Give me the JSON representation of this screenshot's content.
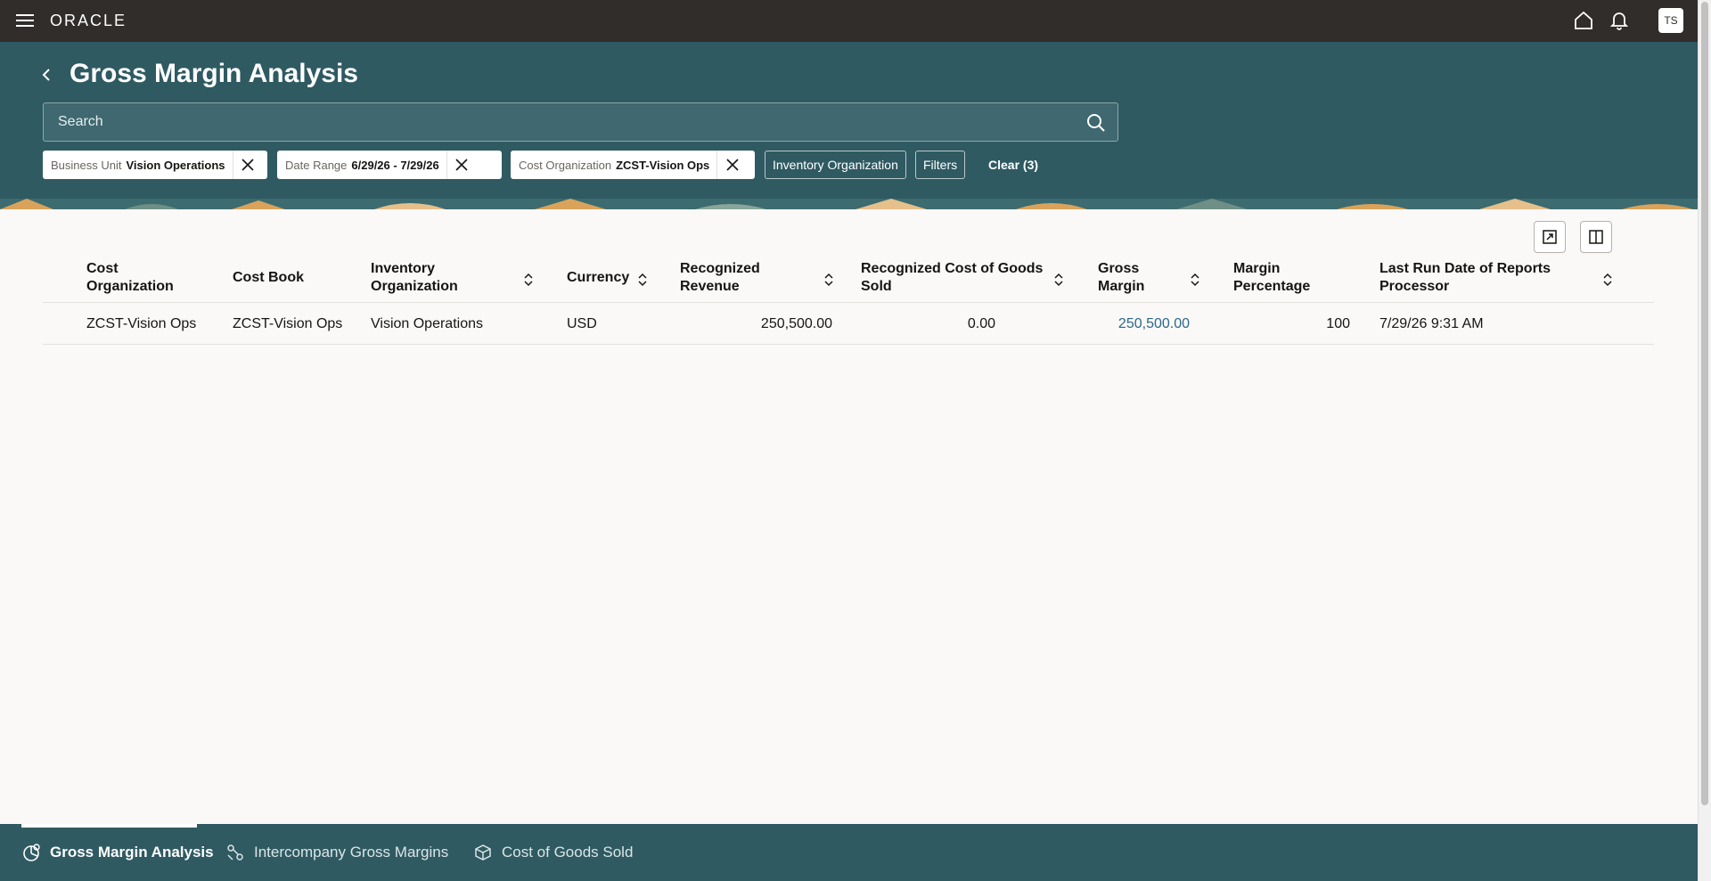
{
  "topbar": {
    "brand": "ORACLE",
    "avatar": "TS",
    "icons": [
      "menu-icon",
      "home-icon",
      "bell-icon"
    ]
  },
  "header": {
    "title": "Gross Margin Analysis",
    "search_placeholder": "Search"
  },
  "filters": [
    {
      "key": "Business Unit",
      "value": "Vision Operations"
    },
    {
      "key": "Date Range",
      "value": "6/29/26 - 7/29/26"
    },
    {
      "key": "Cost Organization",
      "value": "ZCST-Vision Ops"
    }
  ],
  "buttons": {
    "inventory_org": "Inventory Organization",
    "filters": "Filters",
    "clear": "Clear (3)"
  },
  "table": {
    "columns": {
      "cost_org": [
        "Cost",
        "Organization"
      ],
      "cost_book": [
        "Cost Book"
      ],
      "inv_org": [
        "Inventory",
        "Organization"
      ],
      "currency": [
        "Currency"
      ],
      "revenue": [
        "Recognized",
        "Revenue"
      ],
      "cogs": [
        "Recognized Cost of Goods",
        "Sold"
      ],
      "gross_margin": [
        "Gross",
        "Margin"
      ],
      "margin_pct": [
        "Margin",
        "Percentage"
      ],
      "last_run": [
        "Last Run Date of Reports",
        "Processor"
      ]
    },
    "rows": [
      {
        "cost_org": "ZCST-Vision Ops",
        "cost_book": "ZCST-Vision Ops",
        "inv_org": "Vision Operations",
        "currency": "USD",
        "revenue": "250,500.00",
        "cogs": "0.00",
        "gross_margin": "250,500.00",
        "margin_pct": "100",
        "last_run": "7/29/26 9:31 AM"
      }
    ]
  },
  "bottom_tabs": [
    {
      "label": "Gross Margin Analysis",
      "active": true
    },
    {
      "label": "Intercompany Gross Margins",
      "active": false
    },
    {
      "label": "Cost of Goods Sold",
      "active": false
    }
  ],
  "colors": {
    "topbar": "#312d2a",
    "header": "#2f5a62",
    "link": "#2c6888"
  }
}
